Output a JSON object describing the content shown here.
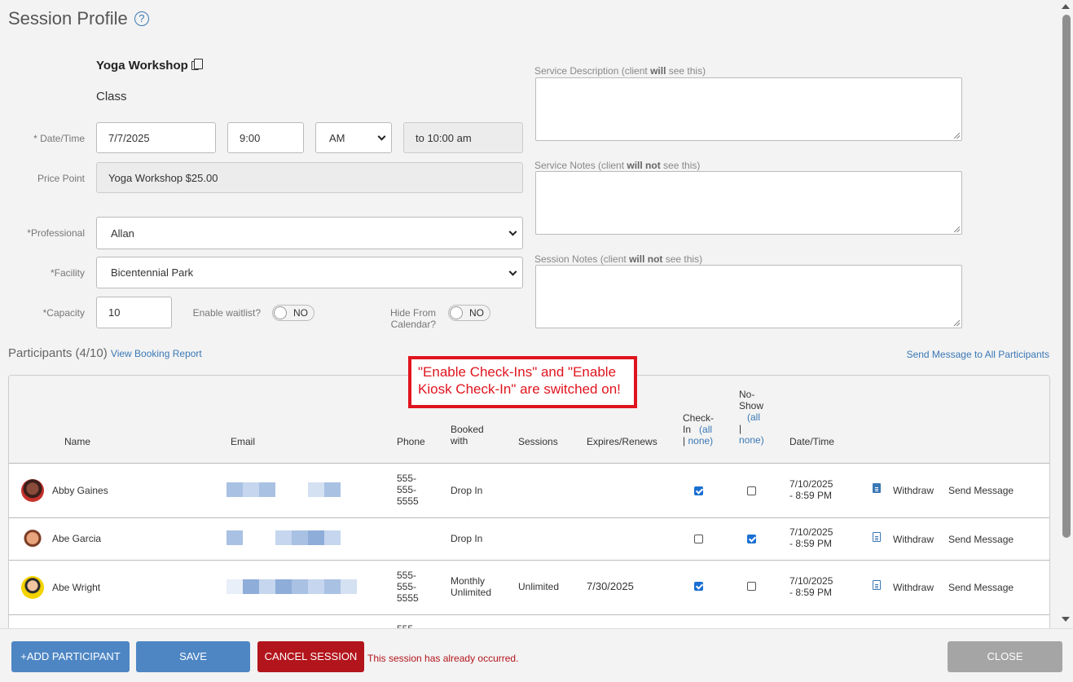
{
  "page": {
    "title": "Session Profile",
    "help_glyph": "?"
  },
  "service": {
    "name": "Yoga Workshop",
    "type": "Class"
  },
  "form": {
    "datetime_label": "* Date/Time",
    "date": "7/7/2025",
    "time": "9:00",
    "ampm": "AM",
    "end_time": "to 10:00 am",
    "price_label": "Price Point",
    "price": "Yoga Workshop $25.00",
    "professional_label": "*Professional",
    "professional": "Allan",
    "facility_label": "*Facility",
    "facility": "Bicentennial Park",
    "capacity_label": "*Capacity",
    "capacity": "10",
    "waitlist_label": "Enable waitlist?",
    "waitlist_value": "NO",
    "hide_label_line1": "Hide From",
    "hide_label_line2": "Calendar?",
    "hide_value": "NO"
  },
  "notes": {
    "service_description": {
      "pre": "Service Description (client ",
      "bold": "will",
      "post": " see this)"
    },
    "service_notes": {
      "pre": "Service Notes (client ",
      "bold": "will not",
      "post": " see this)"
    },
    "session_notes": {
      "pre": "Session Notes (client ",
      "bold": "will not",
      "post": " see this)"
    }
  },
  "participants": {
    "title": "Participants (4/10)",
    "view_report": "View Booking Report",
    "send_all": "Send Message to All Participants",
    "headers": {
      "name": "Name",
      "email": "Email",
      "phone": "Phone",
      "booked_1": "Booked",
      "booked_2": "with",
      "sessions": "Sessions",
      "expires": "Expires/Renews",
      "checkin_1": "Check-",
      "checkin_2": "In",
      "checkin_all": "(all",
      "checkin_sep": "|",
      "checkin_none": "none)",
      "noshow_1": "No-",
      "noshow_2": "Show",
      "noshow_all": "(all",
      "noshow_sep": "|",
      "noshow_none": "none)",
      "datetime": "Date/Time"
    },
    "rows": [
      {
        "name": "Abby Gaines",
        "phone_1": "555-",
        "phone_2": "555-",
        "phone_3": "5555",
        "booked_1": "Drop In",
        "booked_2": "",
        "sessions": "",
        "expires": "",
        "checkin": true,
        "noshow": false,
        "dt_1": "7/10/2025",
        "dt_2": "- 8:59 PM",
        "withdraw": "Withdraw",
        "send": "Send Message"
      },
      {
        "name": "Abe Garcia",
        "phone_1": "",
        "phone_2": "",
        "phone_3": "",
        "booked_1": "Drop In",
        "booked_2": "",
        "sessions": "",
        "expires": "",
        "checkin": false,
        "noshow": true,
        "dt_1": "7/10/2025",
        "dt_2": "- 8:59 PM",
        "withdraw": "Withdraw",
        "send": "Send Message"
      },
      {
        "name": "Abe Wright",
        "phone_1": "555-",
        "phone_2": "555-",
        "phone_3": "5555",
        "booked_1": "Monthly",
        "booked_2": "Unlimited",
        "sessions": "Unlimited",
        "expires": "7/30/2025",
        "checkin": true,
        "noshow": false,
        "dt_1": "7/10/2025",
        "dt_2": "- 8:59 PM",
        "withdraw": "Withdraw",
        "send": "Send Message"
      }
    ],
    "partial_row_phone": "555-"
  },
  "callout": {
    "line1": "\"Enable Check-Ins\" and \"Enable",
    "line2": "Kiosk Check-In\" are switched on!"
  },
  "footer": {
    "add": "+ADD PARTICIPANT",
    "save": "SAVE",
    "cancel": "CANCEL SESSION",
    "occurred": "This session has already occurred.",
    "close": "CLOSE"
  },
  "colors": {
    "link": "#3a78b5",
    "primary_button": "#4e86c4",
    "danger": "#b3151c",
    "callout": "#e0141e",
    "checkbox_on": "#1a6fd1"
  }
}
